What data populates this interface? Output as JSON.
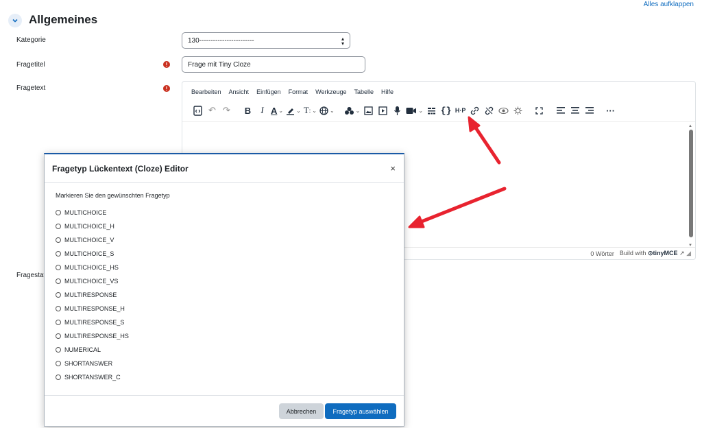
{
  "header": {
    "expand_all": "Alles aufklappen",
    "section_title": "Allgemeines"
  },
  "form": {
    "category_label": "Kategorie",
    "category_value": "130------------------------",
    "title_label": "Fragetitel",
    "title_value": "Frage mit Tiny Cloze",
    "text_label": "Fragetext",
    "status_label": "Fragestat"
  },
  "editor": {
    "menu": [
      "Bearbeiten",
      "Ansicht",
      "Einfügen",
      "Format",
      "Werkzeuge",
      "Tabelle",
      "Hilfe"
    ],
    "word_count": "0 Wörter",
    "build_with": "Build with",
    "brand": "tinyMCE",
    "toolbar_icons": [
      "source-code-icon",
      "undo-icon",
      "redo-icon",
      "bold-icon",
      "italic-icon",
      "text-color-icon",
      "highlight-icon",
      "font-size-icon",
      "language-icon",
      "accessibility-icon",
      "image-icon",
      "media-icon",
      "record-audio-icon",
      "record-video-icon",
      "cloze-icon",
      "equation-icon",
      "h5p-icon",
      "link-icon",
      "unlink-icon",
      "no-autolink-icon",
      "special-chars-icon",
      "fullscreen-icon",
      "align-left-icon",
      "align-center-icon",
      "align-right-icon",
      "more-icon"
    ]
  },
  "modal": {
    "title": "Fragetyp Lückentext (Cloze) Editor",
    "close": "×",
    "instruction": "Markieren Sie den gewünschten Fragetyp",
    "options": [
      "MULTICHOICE",
      "MULTICHOICE_H",
      "MULTICHOICE_V",
      "MULTICHOICE_S",
      "MULTICHOICE_HS",
      "MULTICHOICE_VS",
      "MULTIRESPONSE",
      "MULTIRESPONSE_H",
      "MULTIRESPONSE_S",
      "MULTIRESPONSE_HS",
      "NUMERICAL",
      "SHORTANSWER",
      "SHORTANSWER_C"
    ],
    "cancel_label": "Abbrechen",
    "submit_label": "Fragetyp auswählen"
  },
  "colors": {
    "accent": "#0f6cbf",
    "required": "#ca3120",
    "annotation_arrow": "#e8232f"
  }
}
